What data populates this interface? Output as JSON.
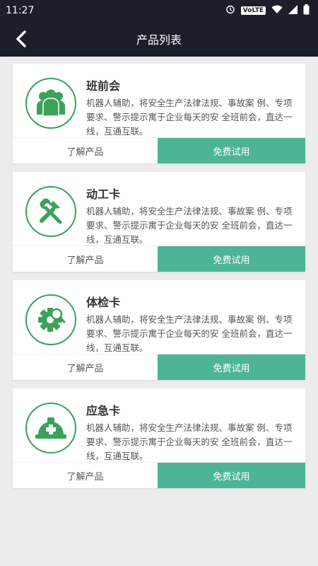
{
  "status_bar": {
    "time": "11:27",
    "network_label": "VoLTE"
  },
  "nav": {
    "title": "产品列表"
  },
  "products": [
    {
      "title": "班前会",
      "description": "机器人辅助，将安全生产法律法规、事故案 例、专项要求、警示提示寓于企业每天的安 全班前会，直达一线，互通互联。",
      "icon": "team-icon",
      "learn_label": "了解产品",
      "trial_label": "免费试用"
    },
    {
      "title": "动工卡",
      "description": "机器人辅助，将安全生产法律法规、事故案 例、专项要求、警示提示寓于企业每天的安 全班前会，直达一线，互通互联。",
      "icon": "tools-icon",
      "learn_label": "了解产品",
      "trial_label": "免费试用"
    },
    {
      "title": "体检卡",
      "description": "机器人辅助，将安全生产法律法规、事故案 例、专项要求、警示提示寓于企业每天的安 全班前会，直达一线，互通互联。",
      "icon": "gear-search-icon",
      "learn_label": "了解产品",
      "trial_label": "免费试用"
    },
    {
      "title": "应急卡",
      "description": "机器人辅助，将安全生产法律法规、事故案 例、专项要求、警示提示寓于企业每天的安 全班前会，直达一线，互通互联。",
      "icon": "helmet-icon",
      "learn_label": "了解产品",
      "trial_label": "免费试用"
    }
  ],
  "colors": {
    "accent": "#3aa25b",
    "button": "#4db595",
    "header": "#1c1e29"
  }
}
